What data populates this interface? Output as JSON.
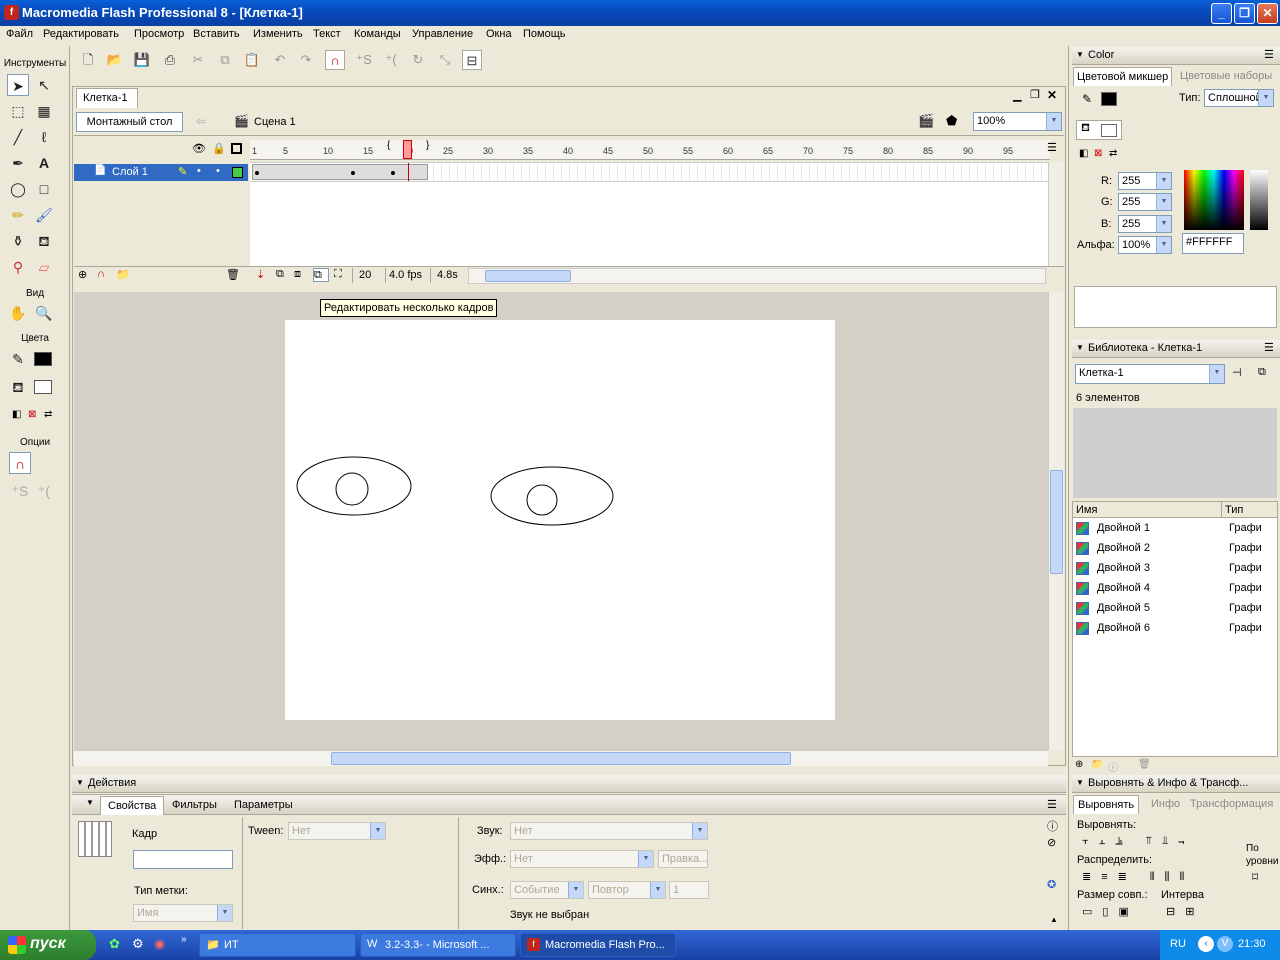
{
  "window": {
    "title": "Macromedia Flash Professional 8 - [Клетка-1]"
  },
  "menu": [
    "Файл",
    "Редактировать",
    "Просмотр",
    "Вставить",
    "Изменить",
    "Текст",
    "Команды",
    "Управление",
    "Окна",
    "Помощь"
  ],
  "tools": {
    "header": "Инструменты",
    "view_label": "Вид",
    "colors_label": "Цвета",
    "options_label": "Опции"
  },
  "document": {
    "tab": "Клетка-1",
    "stage_button": "Монтажный стол",
    "scene": "Сцена 1",
    "zoom": "100%"
  },
  "timeline": {
    "ticks": [
      "1",
      "5",
      "10",
      "15",
      "20",
      "25",
      "30",
      "35",
      "40",
      "45",
      "50",
      "55",
      "60",
      "65",
      "70",
      "75",
      "80",
      "85",
      "90",
      "95"
    ],
    "layer_name": "Слой 1",
    "current_frame": "20",
    "fps": "4.0 fps",
    "time": "4.8s"
  },
  "tooltip": "Редактировать несколько кадров",
  "color_panel": {
    "title": "Color",
    "tab_mixer": "Цветовой микшер",
    "tab_swatches": "Цветовые наборы",
    "type_label": "Тип:",
    "type_value": "Сплошной",
    "r_label": "R:",
    "r": "255",
    "g_label": "G:",
    "g": "255",
    "b_label": "B:",
    "b": "255",
    "alpha_label": "Альфа:",
    "alpha": "100%",
    "hex": "#FFFFFF"
  },
  "library": {
    "title": "Библиотека - Клетка-1",
    "doc": "Клетка-1",
    "count": "6 элементов",
    "col_name": "Имя",
    "col_type": "Тип",
    "items": [
      {
        "name": "Двойной 1",
        "type": "Графи"
      },
      {
        "name": "Двойной 2",
        "type": "Графи"
      },
      {
        "name": "Двойной 3",
        "type": "Графи"
      },
      {
        "name": "Двойной 4",
        "type": "Графи"
      },
      {
        "name": "Двойной 5",
        "type": "Графи"
      },
      {
        "name": "Двойной 6",
        "type": "Графи"
      }
    ]
  },
  "align_panel": {
    "title": "Выровнять & Инфо & Трансф...",
    "tab_align": "Выровнять",
    "tab_info": "Инфо",
    "tab_transform": "Трансформация",
    "align_label": "Выровнять:",
    "distribute_label": "Распределить:",
    "match_size_label": "Размер совп.:",
    "spacing_label": "Интерва",
    "to_stage_label": "По уровни"
  },
  "actions_panel": {
    "title": "Действия"
  },
  "properties": {
    "tab_props": "Свойства",
    "tab_filters": "Фильтры",
    "tab_params": "Параметры",
    "frame_label": "Кадр",
    "tween_label": "Tween:",
    "tween_value": "Нет",
    "label_type": "Тип метки:",
    "label_type_value": "Имя",
    "sound_label": "Звук:",
    "sound_value": "Нет",
    "effect_label": "Эфф.:",
    "effect_value": "Нет",
    "edit_button": "Правка...",
    "sync_label": "Синх.:",
    "sync_value": "Событие",
    "repeat_value": "Повтор",
    "repeat_count": "1",
    "no_sound": "Звук не выбран"
  },
  "taskbar": {
    "start": "пуск",
    "tasks": [
      "ИТ",
      "3.2-3.3- - Microsoft ...",
      "Macromedia Flash Pro..."
    ],
    "lang": "RU",
    "clock": "21:30"
  }
}
